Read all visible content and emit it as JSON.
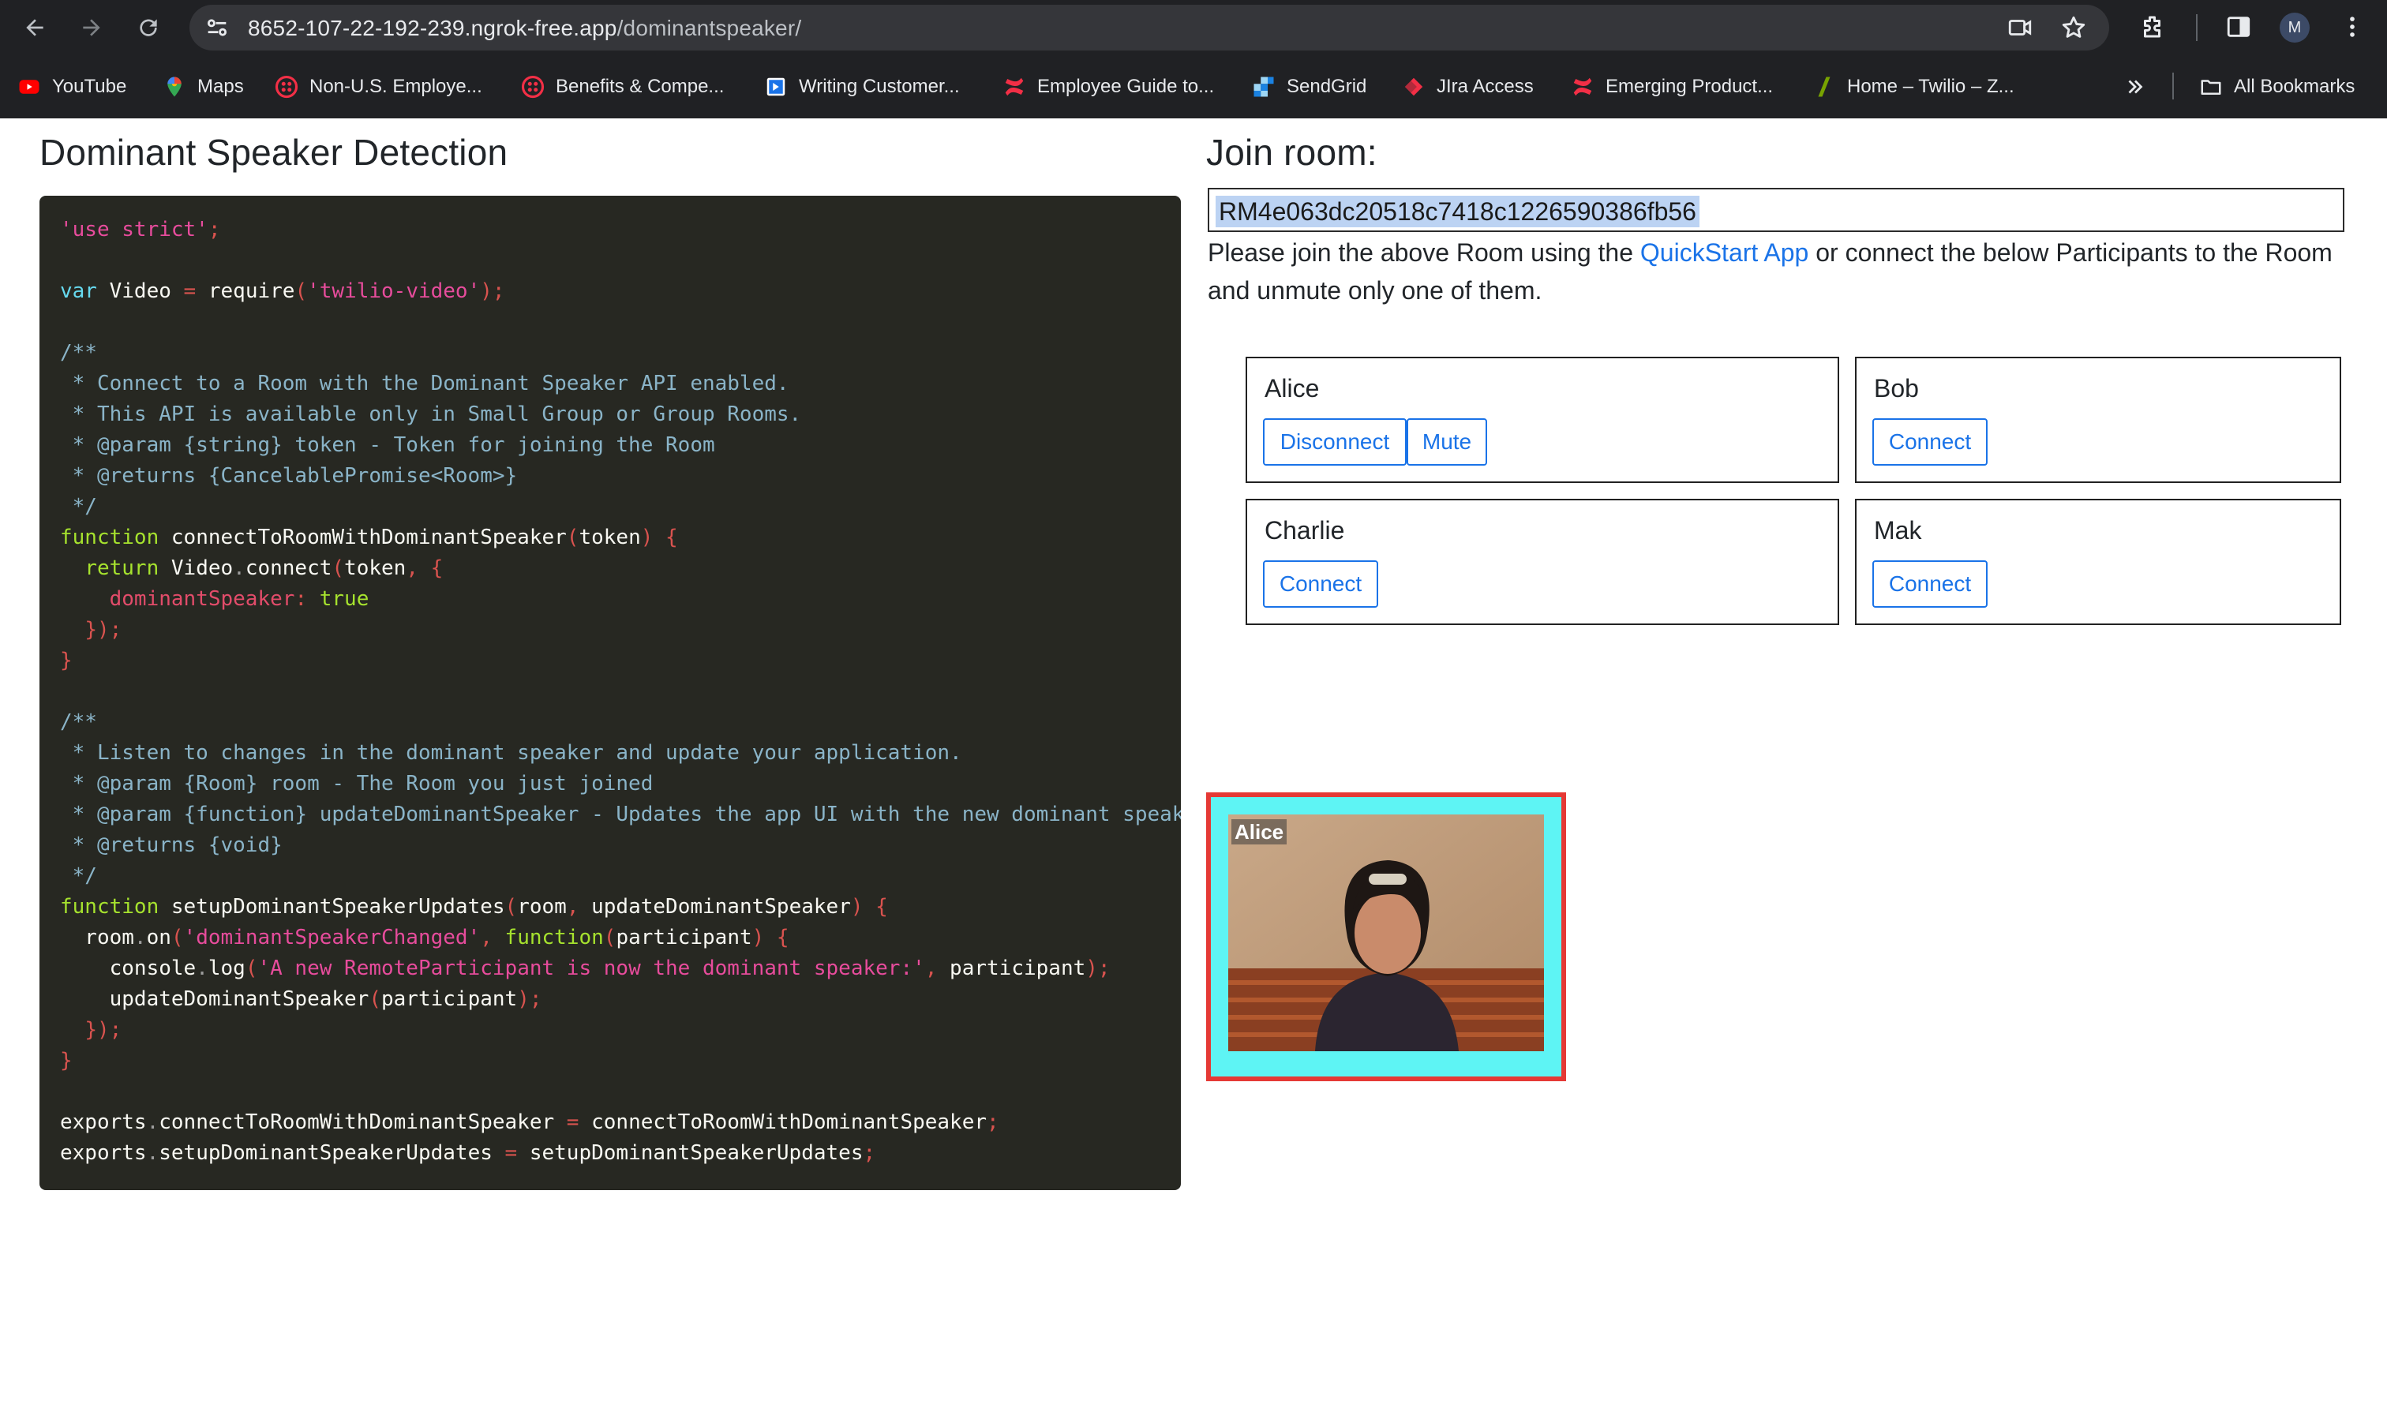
{
  "browser": {
    "url_host": "8652-107-22-192-239.ngrok-free.app",
    "url_path": "/dominantspeaker/",
    "avatar_initial": "M",
    "bookmarks": [
      {
        "label": "YouTube",
        "icon": "youtube-icon",
        "color": "#ff0000"
      },
      {
        "label": "Maps",
        "icon": "maps-icon",
        "color": "#34a853"
      },
      {
        "label": "Non-U.S. Employe...",
        "icon": "twilio-icon",
        "color": "#f22f46"
      },
      {
        "label": "Benefits & Compe...",
        "icon": "twilio-icon",
        "color": "#f22f46"
      },
      {
        "label": "Writing Customer...",
        "icon": "doc-icon",
        "color": "#1a73e8"
      },
      {
        "label": "Employee Guide to...",
        "icon": "confluence-icon",
        "color": "#f22f46"
      },
      {
        "label": "SendGrid",
        "icon": "sendgrid-icon",
        "color": "#1a82e2"
      },
      {
        "label": "JIra Access",
        "icon": "jira-icon",
        "color": "#f22f46"
      },
      {
        "label": "Emerging Product...",
        "icon": "confluence-icon",
        "color": "#f22f46"
      },
      {
        "label": "Home – Twilio – Z...",
        "icon": "zendesk-icon",
        "color": "#78a300"
      }
    ],
    "all_bookmarks_label": "All Bookmarks"
  },
  "left": {
    "title": "Dominant Speaker Detection"
  },
  "right": {
    "title": "Join room:",
    "room_sid": "RM4e063dc20518c7418c1226590386fb56",
    "instructions_before": "Please join the above Room using the ",
    "instructions_link": "QuickStart App",
    "instructions_after": " or connect the below Participants to the Room and unmute only one of them.",
    "participants": [
      {
        "name": "Alice",
        "buttons": [
          "Disconnect",
          "Mute"
        ]
      },
      {
        "name": "Bob",
        "buttons": [
          "Connect"
        ]
      },
      {
        "name": "Charlie",
        "buttons": [
          "Connect"
        ]
      },
      {
        "name": "Mak",
        "buttons": [
          "Connect"
        ]
      }
    ],
    "video": {
      "label": "Alice",
      "border_color": "#e53935",
      "highlight_color": "#5ef4f4"
    }
  }
}
